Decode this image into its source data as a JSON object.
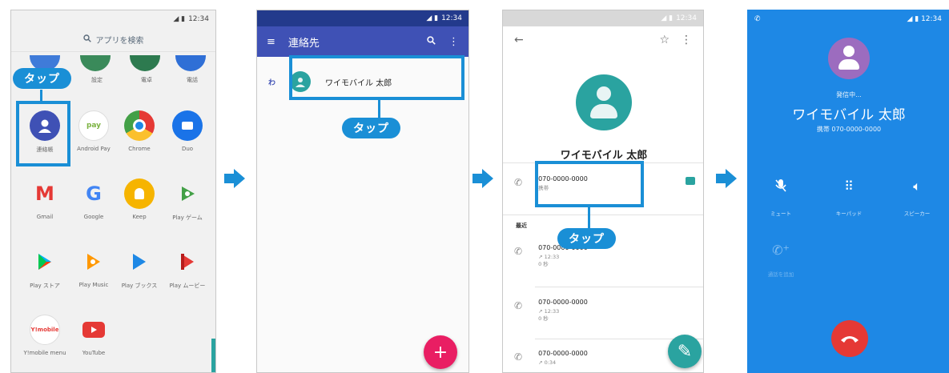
{
  "tap_label": "タップ",
  "colors": {
    "highlight": "#1a8fd6",
    "indigo": "#3f51b5",
    "teal": "#2aa3a0",
    "call_blue": "#1e88e5",
    "end_red": "#e53935",
    "fab_pink": "#e91e63"
  },
  "screen1": {
    "status_time": "12:34",
    "search_placeholder": "アプリを検索",
    "top_row_labels": [
      "設定",
      "電卓",
      "電話"
    ],
    "apps": [
      {
        "label": "連絡帳",
        "icon": "contacts-icon",
        "color": "#3f51b5",
        "highlighted": true
      },
      {
        "label": "Android Pay",
        "icon": "android-pay-icon",
        "color": "#ffffff"
      },
      {
        "label": "Chrome",
        "icon": "chrome-icon",
        "color": "#e53935"
      },
      {
        "label": "Duo",
        "icon": "duo-icon",
        "color": "#1a73e8"
      },
      {
        "label": "Gmail",
        "icon": "gmail-icon",
        "color": "#ffffff"
      },
      {
        "label": "Google",
        "icon": "google-icon",
        "color": "#ffffff"
      },
      {
        "label": "Keep",
        "icon": "keep-icon",
        "color": "#f6b400"
      },
      {
        "label": "Play ゲーム",
        "icon": "play-games-icon",
        "color": "#ffffff"
      },
      {
        "label": "Play ストア",
        "icon": "play-store-icon",
        "color": "#ffffff"
      },
      {
        "label": "Play Music",
        "icon": "play-music-icon",
        "color": "#ffffff"
      },
      {
        "label": "Play ブックス",
        "icon": "play-books-icon",
        "color": "#ffffff"
      },
      {
        "label": "Play ムービー",
        "icon": "play-movies-icon",
        "color": "#ffffff"
      },
      {
        "label": "Y!mobile menu",
        "icon": "ymobile-icon",
        "color": "#ffffff"
      },
      {
        "label": "YouTube",
        "icon": "youtube-icon",
        "color": "#ffffff"
      }
    ]
  },
  "screen2": {
    "status_time": "12:34",
    "title": "連絡先",
    "index_letter": "わ",
    "contact_name": "ワイモバイル 太郎",
    "fab_symbol": "+"
  },
  "screen3": {
    "status_time": "12:34",
    "name": "ワイモバイル 太郎",
    "phone_number": "070-0000-0000",
    "phone_type": "携帯",
    "recent_label": "最近",
    "history": [
      {
        "number": "070-0000-0000",
        "time": "12:33",
        "duration": "0 秒"
      },
      {
        "number": "070-0000-0000",
        "time": "12:33",
        "duration": "0 秒"
      },
      {
        "number": "070-0000-0000",
        "time": "0:34",
        "duration": ""
      }
    ]
  },
  "screen4": {
    "status_time": "12:34",
    "status": "発信中...",
    "name": "ワイモバイル 太郎",
    "number_line": "携帯 070-0000-0000",
    "controls": [
      {
        "label": "ミュート",
        "icon": "mute-icon"
      },
      {
        "label": "キーパッド",
        "icon": "keypad-icon"
      },
      {
        "label": "スピーカー",
        "icon": "speaker-icon"
      }
    ],
    "add_call_label": "通話を追加"
  }
}
